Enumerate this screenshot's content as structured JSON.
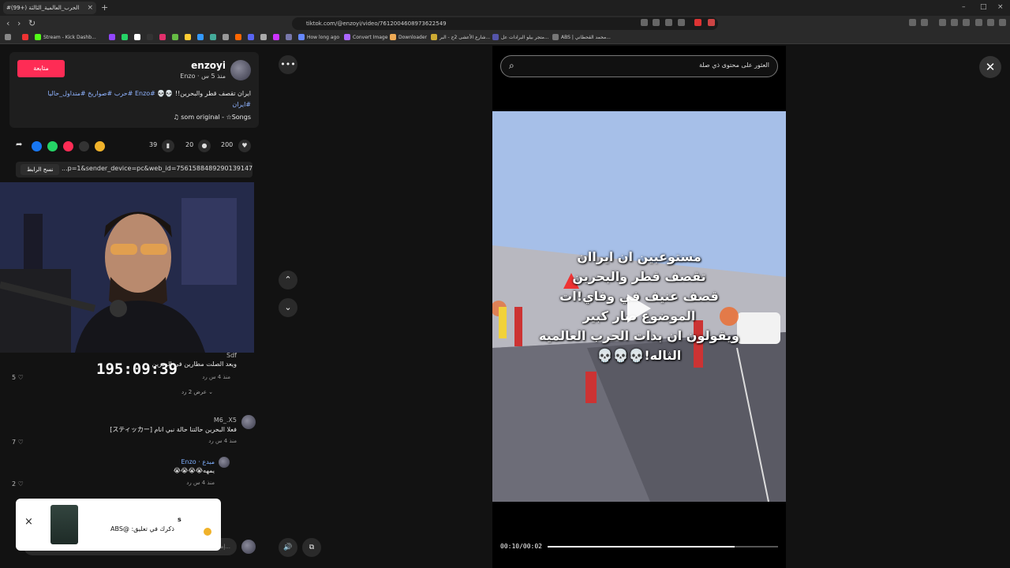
{
  "browser": {
    "tab_title": "#الحرب_العالمية_الثالثة (+99)",
    "tab_close": "×",
    "new_tab": "+",
    "window_controls": [
      "–",
      "□",
      "×"
    ],
    "nav": [
      "‹",
      "›",
      "↻"
    ],
    "url": "tiktok.com/@enzoyi/video/7612004608973622549",
    "bookmarks": [
      "Stream - Kick Dashb...",
      "How long ago",
      "Convert Image",
      "Downloader",
      "شارع الأعشى 2ج - البر...",
      "متجر بيلو البرادات عل...",
      "ABS | محمد القحطاني..."
    ]
  },
  "post": {
    "follow_label": "متابعة",
    "username": "enzoyi",
    "subline": "Enzo · منذ 5 س",
    "caption_text": "ايران تقصف قطر والبحرين!! 💀💀",
    "caption_tags": "#Enzo #حرب #صواريخ #متداول_حاليا",
    "caption_tags2": "#ايران",
    "sound": "♫ som original - ☆Songs",
    "saves": "39",
    "comments": "20",
    "likes": "200",
    "copy_label": "نسخ الرابط",
    "share_link": "...p=1&sender_device=pc&web_id=7561588489290139147"
  },
  "stream_timer": "195:09:39",
  "comments": [
    {
      "name": "Sdf",
      "text": "ويعد الصلت مطارين في البحرين",
      "meta": "منذ 4 س  رد",
      "likes": "5",
      "replies": "عرض 2 رد ⌄"
    },
    {
      "name": "M6_.X5",
      "text": "فعلا البحرين حالتنا حالة نبي انام [スティッカー]",
      "meta": "منذ 4 س  رد",
      "likes": "7"
    },
    {
      "name": "Enzo · مبدع",
      "text": "يمهه😭😭😭😭",
      "meta": "منذ 4 س  رد",
      "likes": "2"
    }
  ],
  "comment_input_placeholder": "إضافة تعليق...",
  "notification": {
    "title": "s",
    "text": "ذكرك في تعليق: @ABS",
    "close": "×"
  },
  "video": {
    "search_placeholder": "العثور على محتوى ذي صلة",
    "overlay_lines": [
      "مستوعبين ان ايراان",
      "تقصف قطر والبحرين",
      "قصف عنيف في وفاي!ات",
      "الموضوع صار كبير",
      "ويقولون ان بدات الحرب العالميه",
      "الثاله!💀💀💀"
    ],
    "time": "00:10/00:02",
    "progress": 0.81
  },
  "controls": {
    "more": "•••",
    "up": "⌃",
    "down": "⌄",
    "volume": "🔊",
    "close": "✕"
  }
}
